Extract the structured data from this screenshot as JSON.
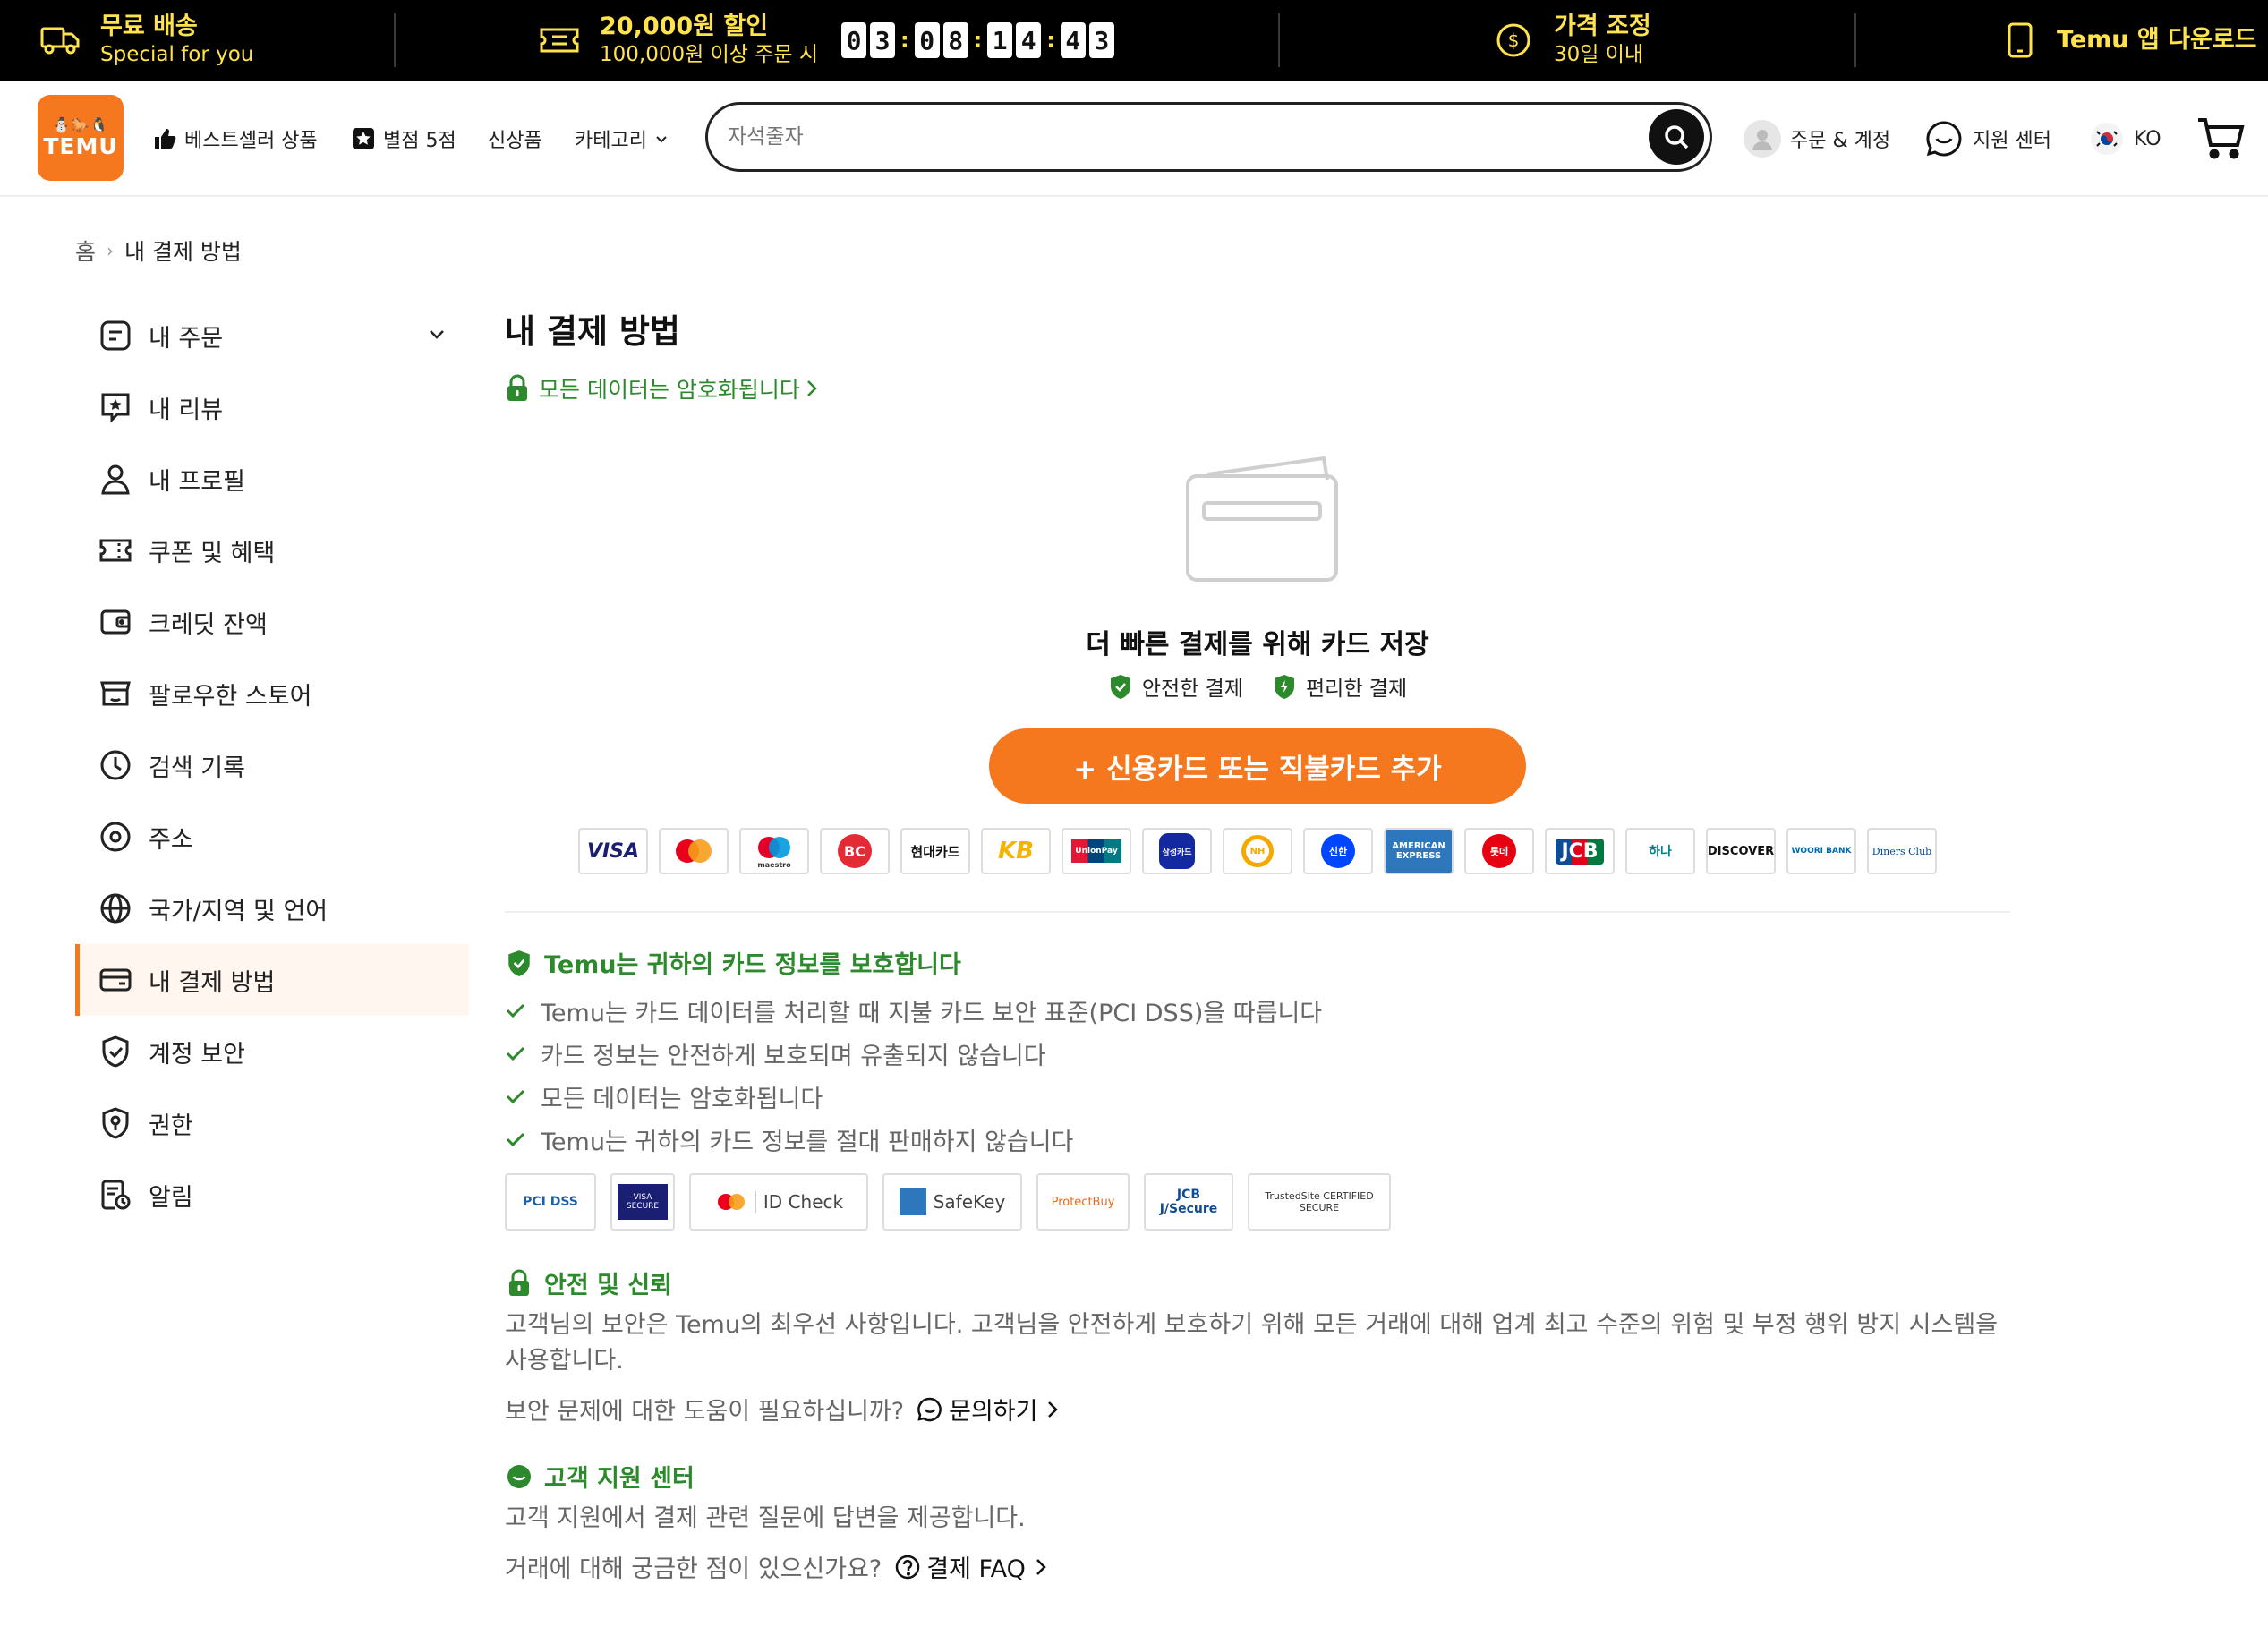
{
  "promo": {
    "free_shipping": {
      "title": "무료 배송",
      "sub": "Special for you"
    },
    "discount": {
      "title": "20,000원 할인",
      "sub": "100,000원 이상 주문 시"
    },
    "timer": [
      "0",
      "3",
      "0",
      "8",
      "1",
      "4",
      "4",
      "3"
    ],
    "price_adjust": {
      "title": "가격 조정",
      "sub": "30일 이내"
    },
    "app": {
      "title": "Temu 앱 다운로드"
    }
  },
  "header": {
    "logo_top": "⛄🐎🐧",
    "logo_text": "TEMU",
    "nav": {
      "bestseller": "베스트셀러 상품",
      "five_star": "별점 5점",
      "new": "신상품",
      "category": "카테고리"
    },
    "search_placeholder": "자석줄자",
    "orders_account": "주문 & 계정",
    "support": "지원 센터",
    "lang": "KO"
  },
  "breadcrumb": {
    "home": "홈",
    "current": "내 결제 방법"
  },
  "sidebar": {
    "items": [
      {
        "label": "내 주문",
        "icon": "order-icon"
      },
      {
        "label": "내 리뷰",
        "icon": "review-icon"
      },
      {
        "label": "내 프로필",
        "icon": "profile-icon"
      },
      {
        "label": "쿠폰 및 혜택",
        "icon": "coupon-icon"
      },
      {
        "label": "크레딧 잔액",
        "icon": "wallet-icon"
      },
      {
        "label": "팔로우한 스토어",
        "icon": "store-icon"
      },
      {
        "label": "검색 기록",
        "icon": "clock-icon"
      },
      {
        "label": "주소",
        "icon": "location-icon"
      },
      {
        "label": "국가/지역 및 언어",
        "icon": "globe-icon"
      },
      {
        "label": "내 결제 방법",
        "icon": "card-icon"
      },
      {
        "label": "계정 보안",
        "icon": "shield-icon"
      },
      {
        "label": "권한",
        "icon": "permission-icon"
      },
      {
        "label": "알림",
        "icon": "notification-icon"
      }
    ]
  },
  "main": {
    "title": "내 결제 방법",
    "encrypted_link": "모든 데이터는 암호화됩니다",
    "save_title": "더 빠른 결제를 위해 카드 저장",
    "badge_safe": "안전한 결제",
    "badge_easy": "편리한 결제",
    "add_button": "+ 신용카드 또는 직불카드 추가",
    "payment_methods": [
      "VISA",
      "Mastercard",
      "maestro",
      "BC",
      "현대카드",
      "KB",
      "UnionPay",
      "삼성카드",
      "NH",
      "신한",
      "AMERICAN EXPRESS",
      "롯데",
      "JCB",
      "하나",
      "DISCOVER",
      "WOORI BANK",
      "Diners Club"
    ],
    "protect": {
      "title": "Temu는 귀하의 카드 정보를 보호합니다",
      "items": [
        "Temu는 카드 데이터를 처리할 때 지불 카드 보안 표준(PCI DSS)을 따릅니다",
        "카드 정보는 안전하게 보호되며 유출되지 않습니다",
        "모든 데이터는 암호화됩니다",
        "Temu는 귀하의 카드 정보를 절대 판매하지 않습니다"
      ],
      "trust_badges": [
        "PCI DSS",
        "VISA SECURE",
        "ID Check",
        "SafeKey",
        "ProtectBuy",
        "JCB J/Secure",
        "TrustedSite CERTIFIED SECURE"
      ]
    },
    "safety": {
      "title": "안전 및 신뢰",
      "para": "고객님의 보안은 Temu의 최우선 사항입니다. 고객님을 안전하게 보호하기 위해 모든 거래에 대해 업계 최고 수준의 위험 및 부정 행위 방지 시스템을 사용합니다.",
      "help_q": "보안 문제에 대한 도움이 필요하십니까?",
      "help_link": "문의하기"
    },
    "support": {
      "title": "고객 지원 센터",
      "para": "고객 지원에서 결제 관련 질문에 답변을 제공합니다.",
      "help_q": "거래에 대해 궁금한 점이 있으신가요?",
      "help_link": "결제 FAQ"
    }
  },
  "colors": {
    "accent": "#f5781f",
    "green": "#2c8a2c",
    "promo_yellow": "#ffe34d"
  }
}
